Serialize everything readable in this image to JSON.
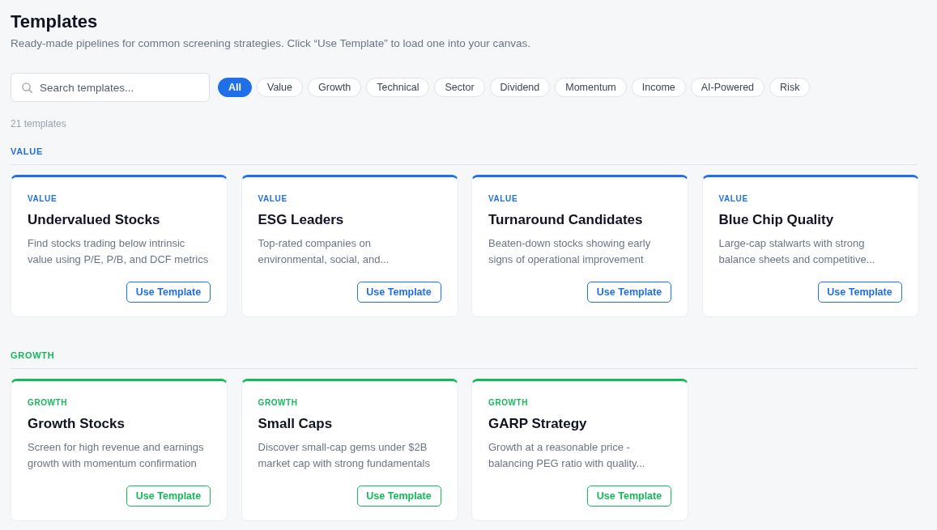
{
  "header": {
    "title": "Templates",
    "subtitle": "Ready-made pipelines for common screening strategies. Click “Use Template” to load one into your canvas."
  },
  "search": {
    "placeholder": "Search templates..."
  },
  "filters": [
    {
      "label": "All",
      "selected": true
    },
    {
      "label": "Value",
      "selected": false
    },
    {
      "label": "Growth",
      "selected": false
    },
    {
      "label": "Technical",
      "selected": false
    },
    {
      "label": "Sector",
      "selected": false
    },
    {
      "label": "Dividend",
      "selected": false
    },
    {
      "label": "Momentum",
      "selected": false
    },
    {
      "label": "Income",
      "selected": false
    },
    {
      "label": "AI-Powered",
      "selected": false
    },
    {
      "label": "Risk",
      "selected": false
    }
  ],
  "count": "21 templates",
  "sections": [
    {
      "heading": "VALUE",
      "color": "#1f6fe8",
      "templates": [
        {
          "category": "VALUE",
          "title": "Undervalued Stocks",
          "description": "Find stocks trading below intrinsic value using P/E, P/B, and DCF metrics",
          "button": "Use Template"
        },
        {
          "category": "VALUE",
          "title": "ESG Leaders",
          "description": "Top-rated companies on environmental, social, and...",
          "button": "Use Template"
        },
        {
          "category": "VALUE",
          "title": "Turnaround Candidates",
          "description": "Beaten-down stocks showing early signs of operational improvement",
          "button": "Use Template"
        },
        {
          "category": "VALUE",
          "title": "Blue Chip Quality",
          "description": "Large-cap stalwarts with strong balance sheets and competitive...",
          "button": "Use Template"
        }
      ]
    },
    {
      "heading": "GROWTH",
      "color": "#15b85a",
      "templates": [
        {
          "category": "GROWTH",
          "title": "Growth Stocks",
          "description": "Screen for high revenue and earnings growth with momentum confirmation",
          "button": "Use Template"
        },
        {
          "category": "GROWTH",
          "title": "Small Caps",
          "description": "Discover small-cap gems under $2B market cap with strong fundamentals",
          "button": "Use Template"
        },
        {
          "category": "GROWTH",
          "title": "GARP Strategy",
          "description": "Growth at a reasonable price - balancing PEG ratio with quality...",
          "button": "Use Template"
        }
      ]
    }
  ]
}
